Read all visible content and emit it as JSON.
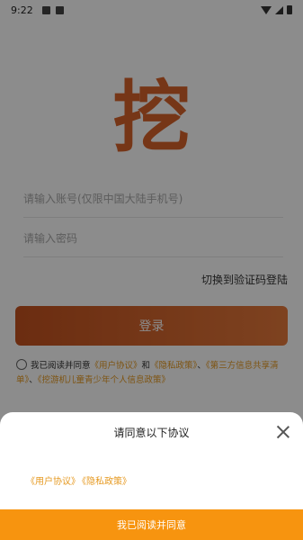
{
  "status_bar": {
    "time": "9:22"
  },
  "logo": {
    "text": "挖"
  },
  "login": {
    "account_placeholder": "请输入账号(仅限中国大陆手机号)",
    "password_placeholder": "请输入密码",
    "switch_mode": "切换到验证码登陆",
    "login_button": "登录",
    "agreement": {
      "prefix": "我已阅读并同意",
      "user_agreement": "《用户协议》",
      "and": "和",
      "privacy_policy": "《隐私政策》",
      "sep1": "、",
      "third_party": "《第三方信息共享清单》",
      "sep2": "、",
      "minor_policy": "《挖游机儿童青少年个人信息政策》"
    }
  },
  "dialog": {
    "title": "请同意以下协议",
    "links": [
      "《用户协议》",
      "《隐私政策》"
    ],
    "confirm_button": "我已阅读并同意"
  },
  "colors": {
    "accent": "#d8632a",
    "link": "#e69a22",
    "confirm": "#f7940f"
  }
}
